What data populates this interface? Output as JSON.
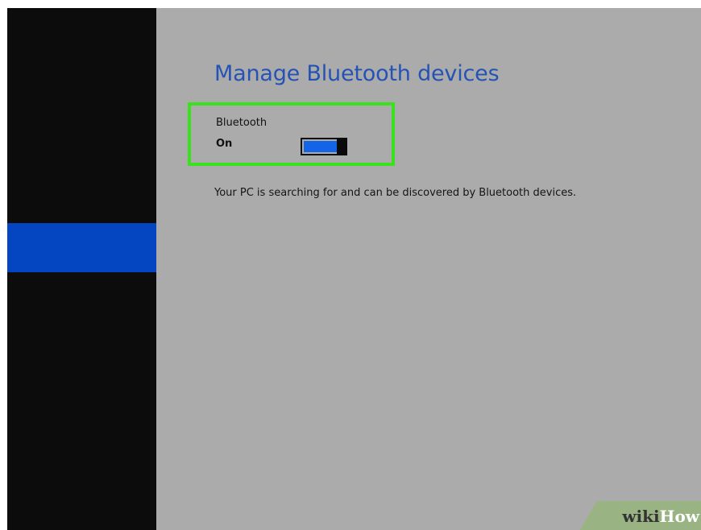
{
  "title": "Manage Bluetooth devices",
  "bluetooth": {
    "label": "Bluetooth",
    "state": "On",
    "enabled": true
  },
  "status": "Your PC is searching for and can be discovered by Bluetooth devices.",
  "watermark": {
    "wiki": "wiki",
    "how": "How"
  },
  "colors": {
    "title": "#2553b5",
    "sidebar_selected": "#0446c2",
    "highlight_box": "#39e21d",
    "toggle_on": "#1464e8"
  }
}
